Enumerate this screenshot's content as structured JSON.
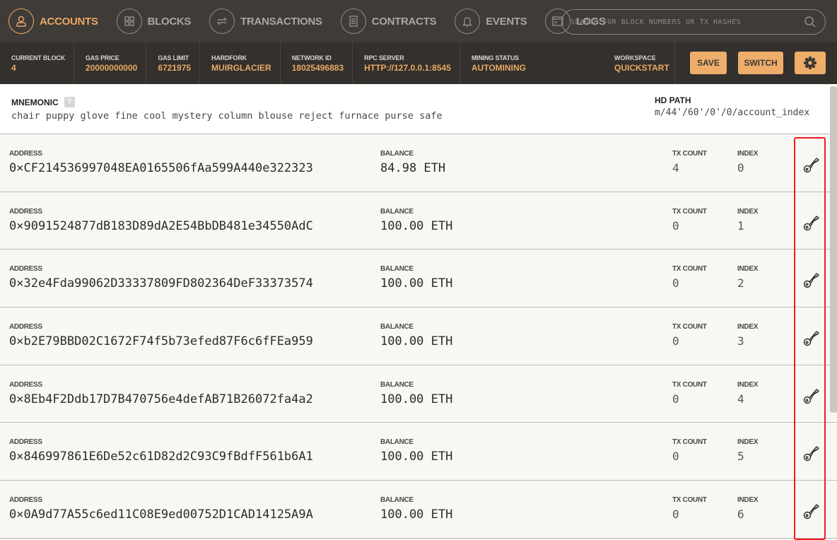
{
  "nav": [
    {
      "label": "ACCOUNTS",
      "icon": "user-icon",
      "active": true
    },
    {
      "label": "BLOCKS",
      "icon": "grid-icon"
    },
    {
      "label": "TRANSACTIONS",
      "icon": "swap-arrows-icon"
    },
    {
      "label": "CONTRACTS",
      "icon": "document-icon"
    },
    {
      "label": "EVENTS",
      "icon": "bell-icon"
    },
    {
      "label": "LOGS",
      "icon": "terminal-icon"
    }
  ],
  "search": {
    "placeholder": "SEARCH FOR BLOCK NUMBERS OR TX HASHES"
  },
  "stats": [
    {
      "label": "CURRENT BLOCK",
      "value": "4"
    },
    {
      "label": "GAS PRICE",
      "value": "20000000000"
    },
    {
      "label": "GAS LIMIT",
      "value": "6721975"
    },
    {
      "label": "HARDFORK",
      "value": "MUIRGLACIER"
    },
    {
      "label": "NETWORK ID",
      "value": "18025496883"
    },
    {
      "label": "RPC SERVER",
      "value": "HTTP://127.0.0.1:8545"
    },
    {
      "label": "MINING STATUS",
      "value": "AUTOMINING"
    }
  ],
  "workspace": {
    "label": "WORKSPACE",
    "value": "QUICKSTART"
  },
  "buttons": {
    "save": "SAVE",
    "switch": "SWITCH"
  },
  "mnemonic": {
    "label": "MNEMONIC",
    "help": "?",
    "words": "chair puppy glove fine cool mystery column blouse reject furnace purse safe"
  },
  "hdpath": {
    "label": "HD PATH",
    "value": "m/44'/60'/0'/0/account_index"
  },
  "labels": {
    "address": "ADDRESS",
    "balance": "BALANCE",
    "txcount": "TX COUNT",
    "index": "INDEX"
  },
  "accounts": [
    {
      "address": "0×CF214536997048EA0165506fAa599A440e322323",
      "balance": "84.98 ETH",
      "tx": "4",
      "index": "0"
    },
    {
      "address": "0×9091524877dB183D89dA2E54BbDB481e34550AdC",
      "balance": "100.00 ETH",
      "tx": "0",
      "index": "1"
    },
    {
      "address": "0×32e4Fda99062D33337809FD802364DeF33373574",
      "balance": "100.00 ETH",
      "tx": "0",
      "index": "2"
    },
    {
      "address": "0×b2E79BBD02C1672F74f5b73efed87F6c6fFEa959",
      "balance": "100.00 ETH",
      "tx": "0",
      "index": "3"
    },
    {
      "address": "0×8Eb4F2Ddb17D7B470756e4defAB71B26072fa4a2",
      "balance": "100.00 ETH",
      "tx": "0",
      "index": "4"
    },
    {
      "address": "0×846997861E6De52c61D82d2C93C9fBdfF561b6A1",
      "balance": "100.00 ETH",
      "tx": "0",
      "index": "5"
    },
    {
      "address": "0×0A9d77A55c6ed11C08E9ed00752D1CAD14125A9A",
      "balance": "100.00 ETH",
      "tx": "0",
      "index": "6"
    }
  ],
  "colors": {
    "accent": "#e8a864",
    "nav_bg": "#3f3b38",
    "stats_bg": "#33302d",
    "highlight": "#f01d1d"
  }
}
